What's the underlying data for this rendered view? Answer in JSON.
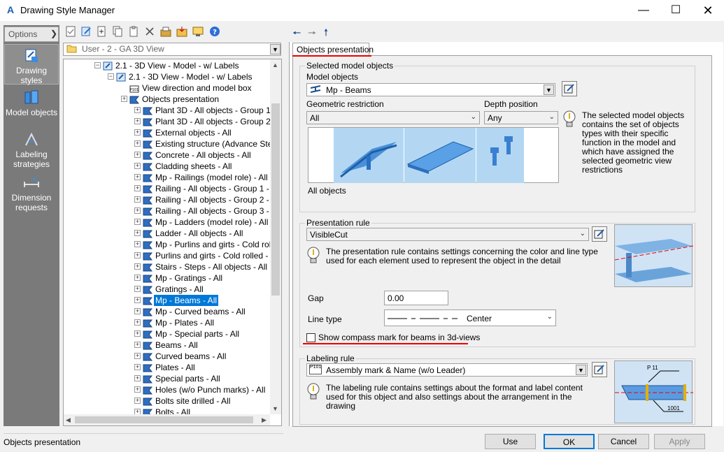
{
  "window": {
    "title": "Drawing Style Manager",
    "app_icon": "A"
  },
  "options_label": "Options",
  "nav": [
    {
      "label": "Drawing styles",
      "icon": "drawing-styles-icon",
      "selected": true
    },
    {
      "label": "Model objects",
      "icon": "model-objects-icon",
      "selected": false
    },
    {
      "label": "Labeling strategies",
      "icon": "labeling-strategies-icon",
      "selected": false
    },
    {
      "label": "Dimension requests",
      "icon": "dimension-requests-icon",
      "selected": false
    }
  ],
  "style_combo": "User - 2 - GA 3D View",
  "tree": [
    {
      "label": "2.1 - 3D View - Model - w/ Labels"
    },
    {
      "label": "2.1 - 3D View - Model - w/ Labels"
    },
    {
      "label": "View direction and model box"
    },
    {
      "label": "Objects presentation"
    },
    {
      "label": "Plant 3D - All objects - Group 1 - A"
    },
    {
      "label": "Plant 3D - All objects - Group 2 - A"
    },
    {
      "label": "External objects - All"
    },
    {
      "label": "Existing structure (Advance Steel"
    },
    {
      "label": "Concrete - All objects - All"
    },
    {
      "label": "Cladding sheets - All"
    },
    {
      "label": "Mp - Railings (model role) - All"
    },
    {
      "label": "Railing - All objects - Group 1 - All"
    },
    {
      "label": "Railing - All objects - Group 2 - All"
    },
    {
      "label": "Railing - All objects - Group 3 - All"
    },
    {
      "label": "Mp - Ladders (model role) - All"
    },
    {
      "label": "Ladder - All objects - All"
    },
    {
      "label": "Mp - Purlins and girts - Cold rolled"
    },
    {
      "label": "Purlins and girts - Cold rolled - All"
    },
    {
      "label": "Stairs - Steps - All objects - All"
    },
    {
      "label": "Mp - Gratings - All"
    },
    {
      "label": "Gratings - All"
    },
    {
      "label": "Mp - Beams - All",
      "selected": true
    },
    {
      "label": "Mp - Curved beams - All"
    },
    {
      "label": "Mp - Plates - All"
    },
    {
      "label": "Mp - Special parts - All"
    },
    {
      "label": "Beams - All"
    },
    {
      "label": "Curved beams - All"
    },
    {
      "label": "Plates - All"
    },
    {
      "label": "Special parts - All"
    },
    {
      "label": "Holes (w/o Punch marks) - All"
    },
    {
      "label": "Bolts site drilled - All"
    },
    {
      "label": "Bolts - All"
    }
  ],
  "tab": "Objects presentation",
  "selected_model": {
    "group_title": "Selected model objects",
    "model_objects_label": "Model objects",
    "model_objects_value": "Mp - Beams",
    "geo_label": "Geometric restriction",
    "geo_value": "All",
    "depth_label": "Depth position",
    "depth_value": "Any",
    "hint": "The selected model objects contains the set of objects types with their specific function in the model and which have assigned the selected geometric view restrictions",
    "preview_caption": "All objects"
  },
  "presentation": {
    "group_title": "Presentation rule",
    "value": "VisibleCut",
    "hint": "The presentation rule contains settings concerning the color and line type used for each element used to represent the object in the detail",
    "gap_label": "Gap",
    "gap_value": "0.00",
    "linetype_label": "Line type",
    "linetype_value": "Center",
    "compass_label": "Show compass mark for beams in 3d-views",
    "compass_checked": false
  },
  "labeling": {
    "group_title": "Labeling rule",
    "value": "Assembly mark & Name (w/o Leader)",
    "hint": "The labeling rule contains settings about the format and label content used for this object and also settings about the arrangement in the drawing",
    "preview_p": "P 11",
    "preview_num": "1001"
  },
  "buttons": {
    "use": "Use",
    "ok": "OK",
    "cancel": "Cancel",
    "apply": "Apply"
  },
  "status": "Objects presentation",
  "colors": {
    "selection": "#0078d7",
    "annotation": "#e00000",
    "nav_bg": "#7a7a7a"
  }
}
